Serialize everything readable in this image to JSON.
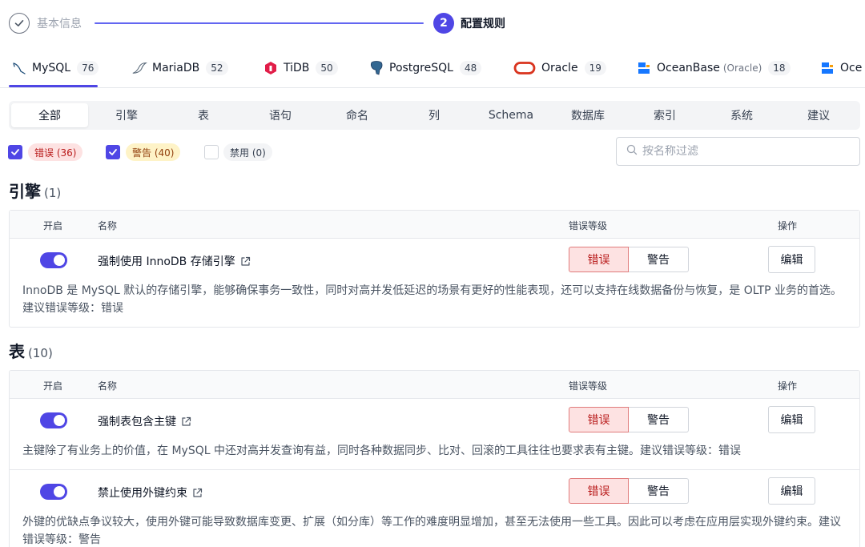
{
  "stepper": {
    "step1_label": "基本信息",
    "step2_number": "2",
    "step2_label": "配置规则"
  },
  "db_tabs": [
    {
      "name": "MySQL",
      "sub": "",
      "count": "76",
      "icon": "mysql-dolphin-icon"
    },
    {
      "name": "MariaDB",
      "sub": "",
      "count": "52",
      "icon": "mariadb-seal-icon"
    },
    {
      "name": "TiDB",
      "sub": "",
      "count": "50",
      "icon": "tidb-logo-icon"
    },
    {
      "name": "PostgreSQL",
      "sub": "",
      "count": "48",
      "icon": "postgresql-elephant-icon"
    },
    {
      "name": "Oracle",
      "sub": "",
      "count": "19",
      "icon": "oracle-logo-icon"
    },
    {
      "name": "OceanBase",
      "sub": "(Oracle)",
      "count": "18",
      "icon": "oceanbase-logo-icon"
    },
    {
      "name": "Oce",
      "sub": "",
      "count": "",
      "icon": "oceanbase-logo-icon"
    }
  ],
  "categories": [
    "全部",
    "引擎",
    "表",
    "语句",
    "命名",
    "列",
    "Schema",
    "数据库",
    "索引",
    "系统",
    "建议"
  ],
  "filters": {
    "error": "错误 (36)",
    "warning": "警告 (40)",
    "disabled": "禁用 (0)",
    "search_placeholder": "按名称过滤"
  },
  "columns": {
    "enabled": "开启",
    "name": "名称",
    "level": "错误等级",
    "action": "操作"
  },
  "level_labels": {
    "error": "错误",
    "warning": "警告"
  },
  "edit_label": "编辑",
  "sections": [
    {
      "title": "引擎",
      "count": "(1)",
      "rules": [
        {
          "name": "强制使用 InnoDB 存储引擎",
          "level": "error",
          "desc": "InnoDB 是 MySQL 默认的存储引擎，能够确保事务一致性，同时对高并发低延迟的场景有更好的性能表现，还可以支持在线数据备份与恢复，是 OLTP 业务的首选。建议错误等级：错误"
        }
      ]
    },
    {
      "title": "表",
      "count": "(10)",
      "rules": [
        {
          "name": "强制表包含主键",
          "level": "error",
          "desc": "主键除了有业务上的价值，在 MySQL 中还对高并发查询有益，同时各种数据同步、比对、回滚的工具往往也要求表有主键。建议错误等级：错误"
        },
        {
          "name": "禁止使用外键约束",
          "level": "error",
          "desc": "外键的优缺点争议较大，使用外键可能导致数据库变更、扩展（如分库）等工作的难度明显增加，甚至无法使用一些工具。因此可以考虑在应用层实现外键约束。建议错误等级：警告"
        }
      ]
    }
  ]
}
